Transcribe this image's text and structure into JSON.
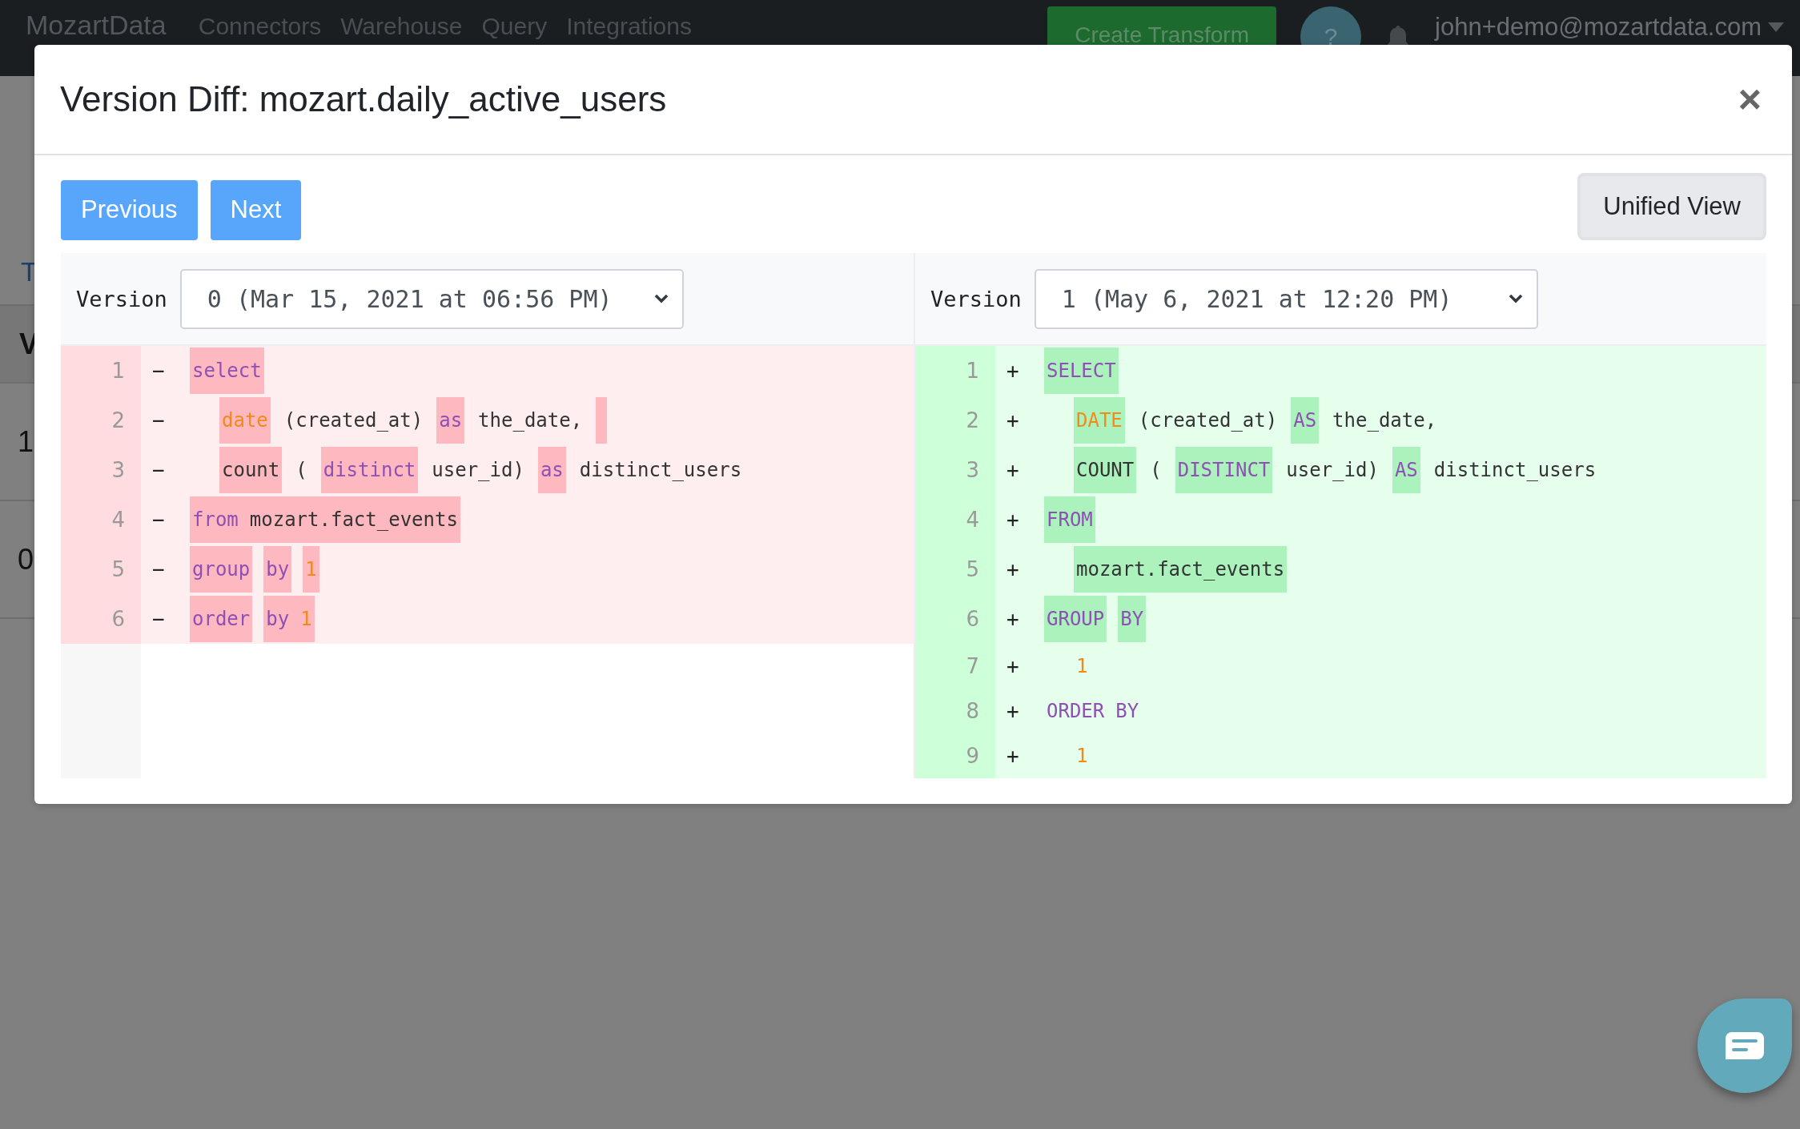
{
  "navbar": {
    "brand": "MozartData",
    "links": [
      "Connectors",
      "Warehouse",
      "Query",
      "Integrations"
    ],
    "create_button": "Create Transform",
    "help_button": "?",
    "user_menu": "john+demo@mozartdata.com"
  },
  "background": {
    "link": "T",
    "header": "V",
    "rows": [
      "1",
      "0"
    ]
  },
  "modal": {
    "title": "Version Diff: mozart.daily_active_users",
    "close": "×",
    "nav_buttons": [
      "Previous",
      "Next"
    ],
    "view_button": "Unified View",
    "panes": [
      {
        "kind": "removed",
        "version_label": "Version",
        "version": "0 (Mar 15, 2021 at 06:56 PM)",
        "lines": [
          {
            "number": "1",
            "sign": "−",
            "indented": false,
            "segments": [
              {
                "highlighted": true,
                "tokens": [
                  {
                    "text": "select",
                    "kind": "keyword"
                  }
                ]
              }
            ]
          },
          {
            "number": "2",
            "sign": "−",
            "indented": true,
            "segments": [
              {
                "highlighted": true,
                "tokens": [
                  {
                    "text": "date",
                    "kind": "function"
                  }
                ]
              },
              {
                "highlighted": false,
                "tokens": [
                  {
                    "text": "(created_at)",
                    "kind": "plain"
                  }
                ]
              },
              {
                "highlighted": true,
                "tokens": [
                  {
                    "text": "as",
                    "kind": "keyword"
                  }
                ]
              },
              {
                "highlighted": false,
                "tokens": [
                  {
                    "text": "the_date,",
                    "kind": "plain"
                  }
                ]
              },
              {
                "highlighted": true
              }
            ]
          },
          {
            "number": "3",
            "sign": "−",
            "indented": true,
            "segments": [
              {
                "highlighted": true,
                "tokens": [
                  {
                    "text": "count",
                    "kind": "plain"
                  }
                ]
              },
              {
                "highlighted": false,
                "tokens": [
                  {
                    "text": "(",
                    "kind": "plain"
                  }
                ]
              },
              {
                "highlighted": true,
                "tokens": [
                  {
                    "text": "distinct",
                    "kind": "keyword"
                  }
                ]
              },
              {
                "highlighted": false,
                "tokens": [
                  {
                    "text": "user_id)",
                    "kind": "plain"
                  }
                ]
              },
              {
                "highlighted": true,
                "tokens": [
                  {
                    "text": "as",
                    "kind": "keyword"
                  }
                ]
              },
              {
                "highlighted": false,
                "tokens": [
                  {
                    "text": "distinct_users",
                    "kind": "plain"
                  }
                ]
              }
            ]
          },
          {
            "number": "4",
            "sign": "−",
            "indented": false,
            "segments": [
              {
                "highlighted": true,
                "tokens": [
                  {
                    "text": "from",
                    "kind": "keyword"
                  },
                  {
                    "text": "mozart.fact_events",
                    "kind": "plain"
                  }
                ]
              }
            ]
          },
          {
            "number": "5",
            "sign": "−",
            "indented": false,
            "segments": [
              {
                "highlighted": true,
                "tokens": [
                  {
                    "text": "group",
                    "kind": "keyword"
                  }
                ]
              },
              {
                "highlighted": true,
                "tokens": [
                  {
                    "text": "by",
                    "kind": "keyword"
                  }
                ]
              },
              {
                "highlighted": true,
                "tokens": [
                  {
                    "text": "1",
                    "kind": "number"
                  }
                ]
              }
            ]
          },
          {
            "number": "6",
            "sign": "−",
            "indented": false,
            "segments": [
              {
                "highlighted": true,
                "tokens": [
                  {
                    "text": "order",
                    "kind": "keyword"
                  }
                ]
              },
              {
                "highlighted": true,
                "tokens": [
                  {
                    "text": "by",
                    "kind": "keyword"
                  },
                  {
                    "text": "1",
                    "kind": "number"
                  }
                ]
              }
            ]
          }
        ]
      },
      {
        "kind": "added",
        "version_label": "Version",
        "version": "1 (May 6, 2021 at 12:20 PM)",
        "lines": [
          {
            "number": "1",
            "sign": "+",
            "indented": false,
            "segments": [
              {
                "highlighted": true,
                "tokens": [
                  {
                    "text": "SELECT",
                    "kind": "keyword"
                  }
                ]
              }
            ]
          },
          {
            "number": "2",
            "sign": "+",
            "indented": true,
            "segments": [
              {
                "highlighted": true,
                "tokens": [
                  {
                    "text": "DATE",
                    "kind": "function"
                  }
                ]
              },
              {
                "highlighted": false,
                "tokens": [
                  {
                    "text": "(created_at)",
                    "kind": "plain"
                  }
                ]
              },
              {
                "highlighted": true,
                "tokens": [
                  {
                    "text": "AS",
                    "kind": "keyword"
                  }
                ]
              },
              {
                "highlighted": false,
                "tokens": [
                  {
                    "text": "the_date,",
                    "kind": "plain"
                  }
                ]
              }
            ]
          },
          {
            "number": "3",
            "sign": "+",
            "indented": true,
            "segments": [
              {
                "highlighted": true,
                "tokens": [
                  {
                    "text": "COUNT",
                    "kind": "plain"
                  }
                ]
              },
              {
                "highlighted": false,
                "tokens": [
                  {
                    "text": "(",
                    "kind": "plain"
                  }
                ]
              },
              {
                "highlighted": true,
                "tokens": [
                  {
                    "text": "DISTINCT",
                    "kind": "keyword"
                  }
                ]
              },
              {
                "highlighted": false,
                "tokens": [
                  {
                    "text": "user_id)",
                    "kind": "plain"
                  }
                ]
              },
              {
                "highlighted": true,
                "tokens": [
                  {
                    "text": "AS",
                    "kind": "keyword"
                  }
                ]
              },
              {
                "highlighted": false,
                "tokens": [
                  {
                    "text": "distinct_users",
                    "kind": "plain"
                  }
                ]
              }
            ]
          },
          {
            "number": "4",
            "sign": "+",
            "indented": false,
            "segments": [
              {
                "highlighted": true,
                "tokens": [
                  {
                    "text": "FROM",
                    "kind": "keyword"
                  }
                ]
              }
            ]
          },
          {
            "number": "5",
            "sign": "+",
            "indented": true,
            "segments": [
              {
                "highlighted": true,
                "tokens": [
                  {
                    "text": "mozart.fact_events",
                    "kind": "plain"
                  }
                ]
              }
            ]
          },
          {
            "number": "6",
            "sign": "+",
            "indented": false,
            "segments": [
              {
                "highlighted": true,
                "tokens": [
                  {
                    "text": "GROUP",
                    "kind": "keyword"
                  }
                ]
              },
              {
                "highlighted": true,
                "tokens": [
                  {
                    "text": "BY",
                    "kind": "keyword"
                  }
                ]
              }
            ]
          },
          {
            "number": "7",
            "sign": "+",
            "indented": true,
            "segments": [
              {
                "highlighted": false,
                "tokens": [
                  {
                    "text": "1",
                    "kind": "number"
                  }
                ]
              }
            ]
          },
          {
            "number": "8",
            "sign": "+",
            "indented": false,
            "segments": [
              {
                "highlighted": false,
                "tokens": [
                  {
                    "text": "ORDER",
                    "kind": "keyword"
                  },
                  {
                    "text": "BY",
                    "kind": "keyword"
                  }
                ]
              }
            ]
          },
          {
            "number": "9",
            "sign": "+",
            "indented": true,
            "segments": [
              {
                "highlighted": false,
                "tokens": [
                  {
                    "text": "1",
                    "kind": "number"
                  }
                ]
              }
            ]
          }
        ]
      }
    ]
  }
}
